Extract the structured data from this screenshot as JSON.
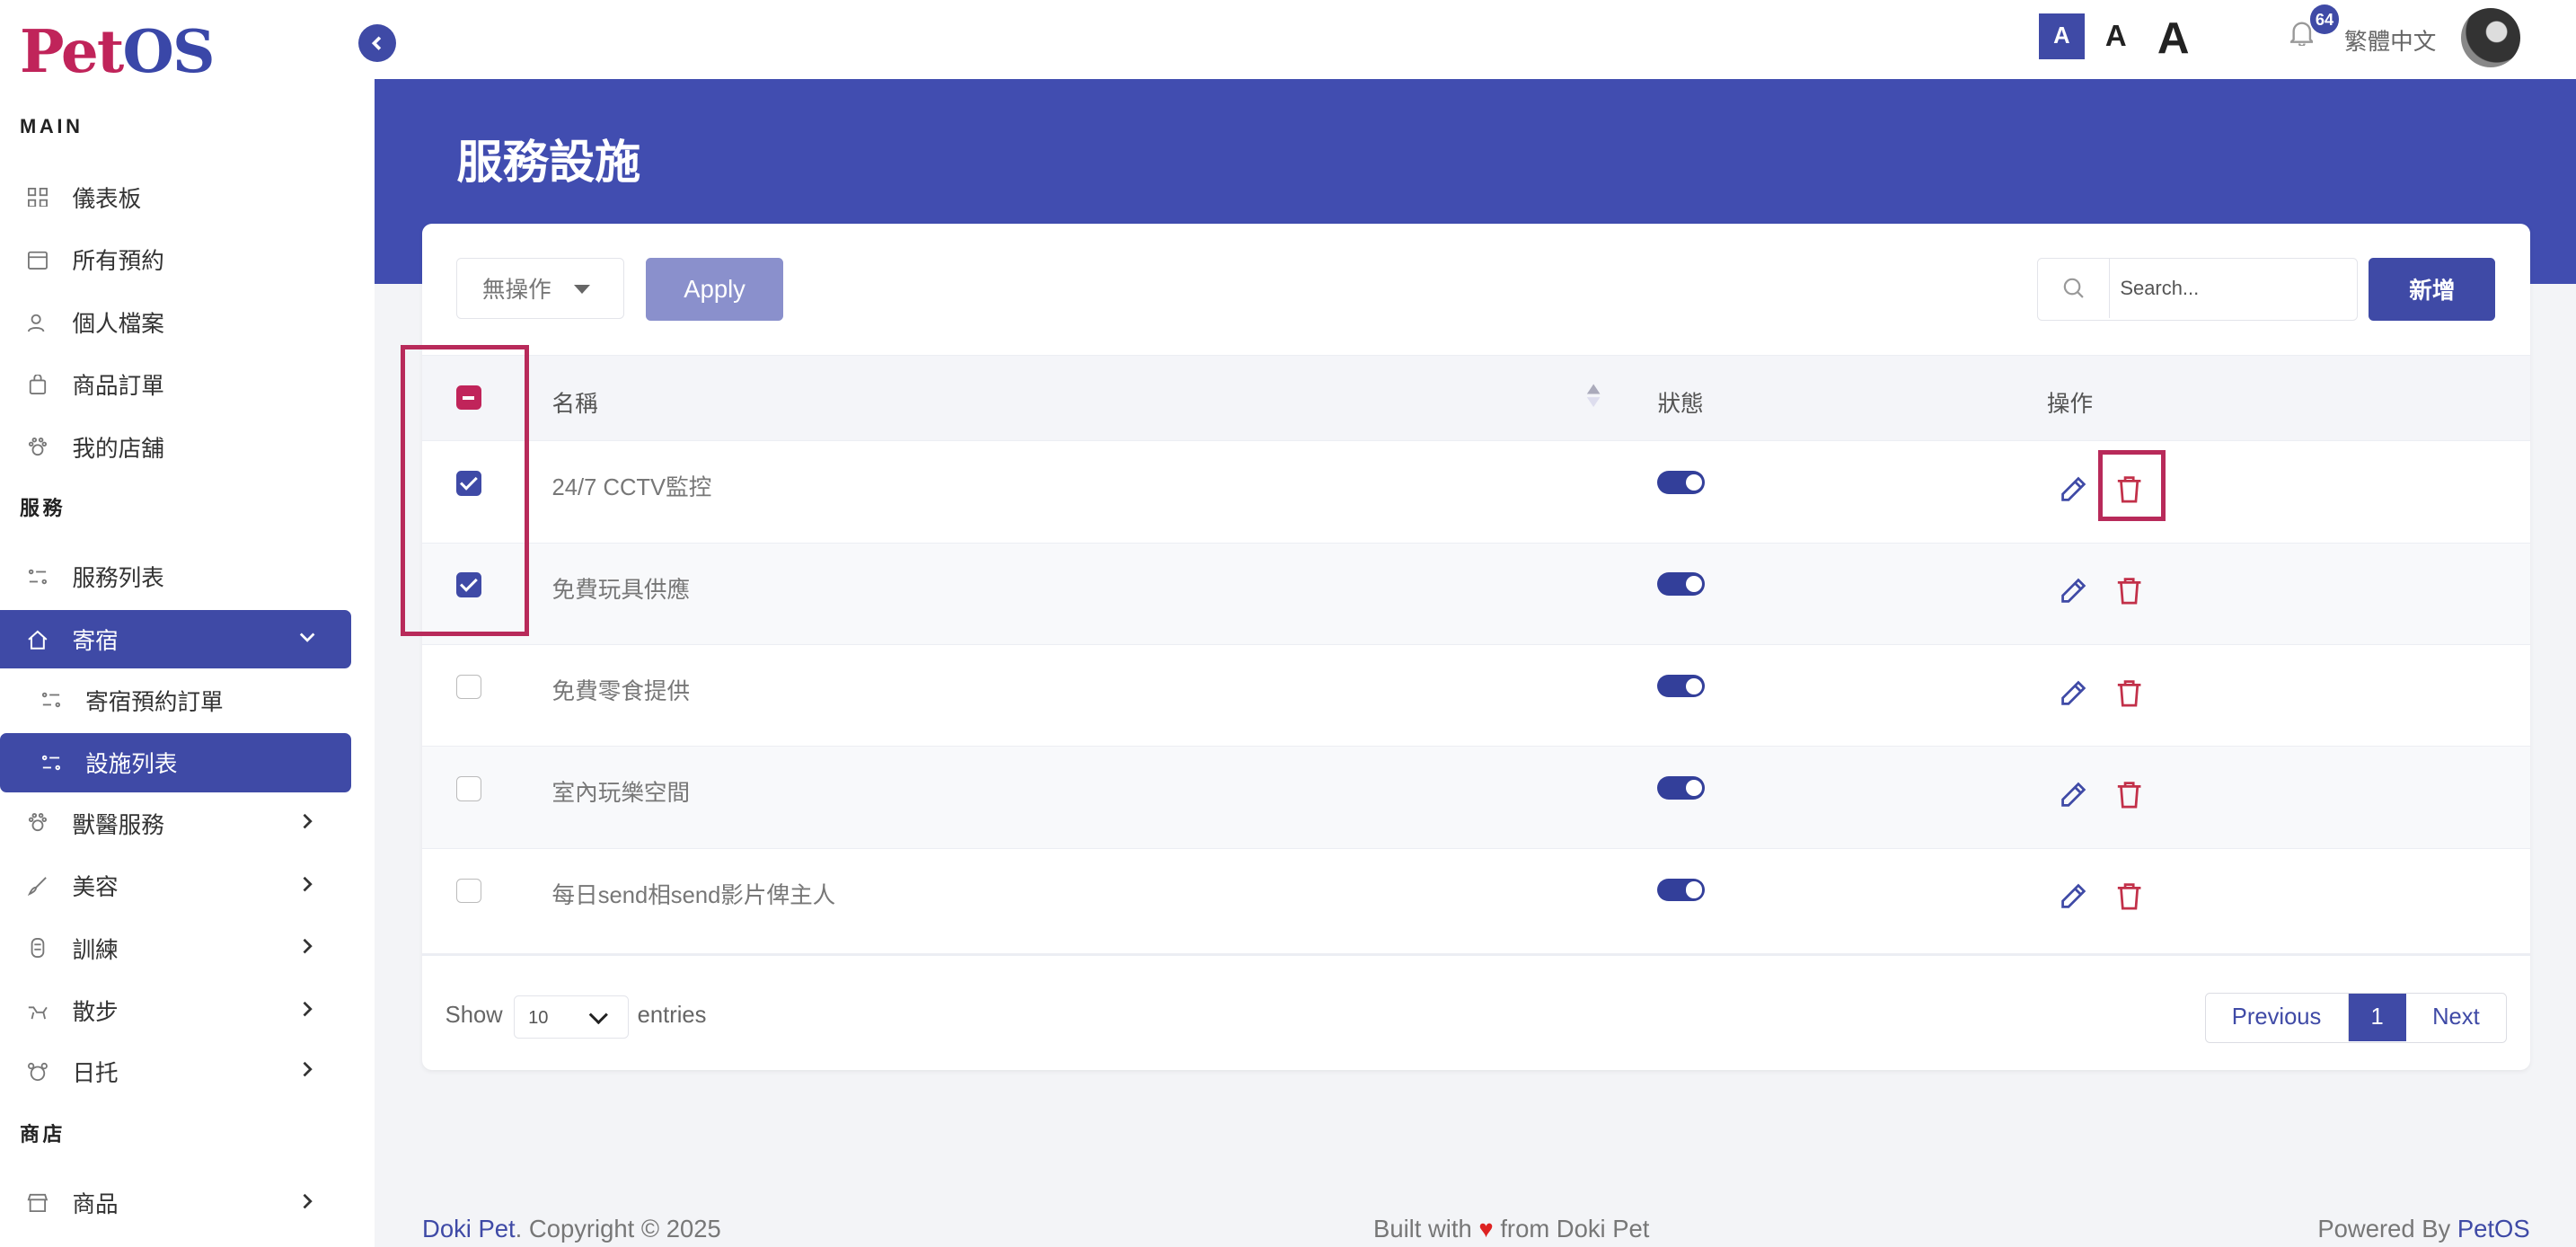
{
  "logo": {
    "pet": "Pet",
    "os": "OS"
  },
  "sidebar": {
    "sections": {
      "main": "MAIN",
      "service": "服務",
      "shop": "商店"
    },
    "items": [
      {
        "label": "儀表板",
        "icon": "dashboard-icon"
      },
      {
        "label": "所有預約",
        "icon": "calendar-icon"
      },
      {
        "label": "個人檔案",
        "icon": "user-icon"
      },
      {
        "label": "商品訂單",
        "icon": "bag-icon"
      },
      {
        "label": "我的店舖",
        "icon": "paw-icon"
      },
      {
        "label": "服務列表",
        "icon": "list-icon"
      },
      {
        "label": "寄宿",
        "icon": "home-icon"
      },
      {
        "label": "寄宿預約訂單",
        "icon": "list-icon"
      },
      {
        "label": "設施列表",
        "icon": "list-icon"
      },
      {
        "label": "獸醫服務",
        "icon": "paw-icon"
      },
      {
        "label": "美容",
        "icon": "brush-icon"
      },
      {
        "label": "訓練",
        "icon": "training-icon"
      },
      {
        "label": "散步",
        "icon": "dog-walk-icon"
      },
      {
        "label": "日托",
        "icon": "daycare-icon"
      },
      {
        "label": "商品",
        "icon": "store-icon"
      }
    ]
  },
  "topbar": {
    "font_small": "A",
    "font_medium": "A",
    "font_large": "A",
    "notification_count": "64",
    "language": "繁體中文"
  },
  "page": {
    "title": "服務設施"
  },
  "toolbar": {
    "bulk_action": "無操作",
    "apply_label": "Apply",
    "search_placeholder": "Search...",
    "add_label": "新增"
  },
  "table": {
    "headers": {
      "name": "名稱",
      "status": "狀態",
      "actions": "操作"
    },
    "rows": [
      {
        "name": "24/7 CCTV監控",
        "checked": true,
        "enabled": true
      },
      {
        "name": "免費玩具供應",
        "checked": true,
        "enabled": true
      },
      {
        "name": "免費零食提供",
        "checked": false,
        "enabled": true
      },
      {
        "name": "室內玩樂空間",
        "checked": false,
        "enabled": true
      },
      {
        "name": "每日send相send影片俾主人",
        "checked": false,
        "enabled": true
      }
    ]
  },
  "pagination": {
    "show": "Show",
    "page_size": "10",
    "entries": "entries",
    "previous": "Previous",
    "current": "1",
    "next": "Next"
  },
  "footer": {
    "brand": "Doki Pet",
    "copyright": ". Copyright © 2025",
    "built_prefix": "Built with",
    "built_suffix": "from Doki Pet",
    "powered_prefix": "Powered By",
    "powered_brand": "PetOS"
  },
  "colors": {
    "primary": "#3f4aa6",
    "accent": "#c0245a",
    "danger": "#c23049"
  }
}
